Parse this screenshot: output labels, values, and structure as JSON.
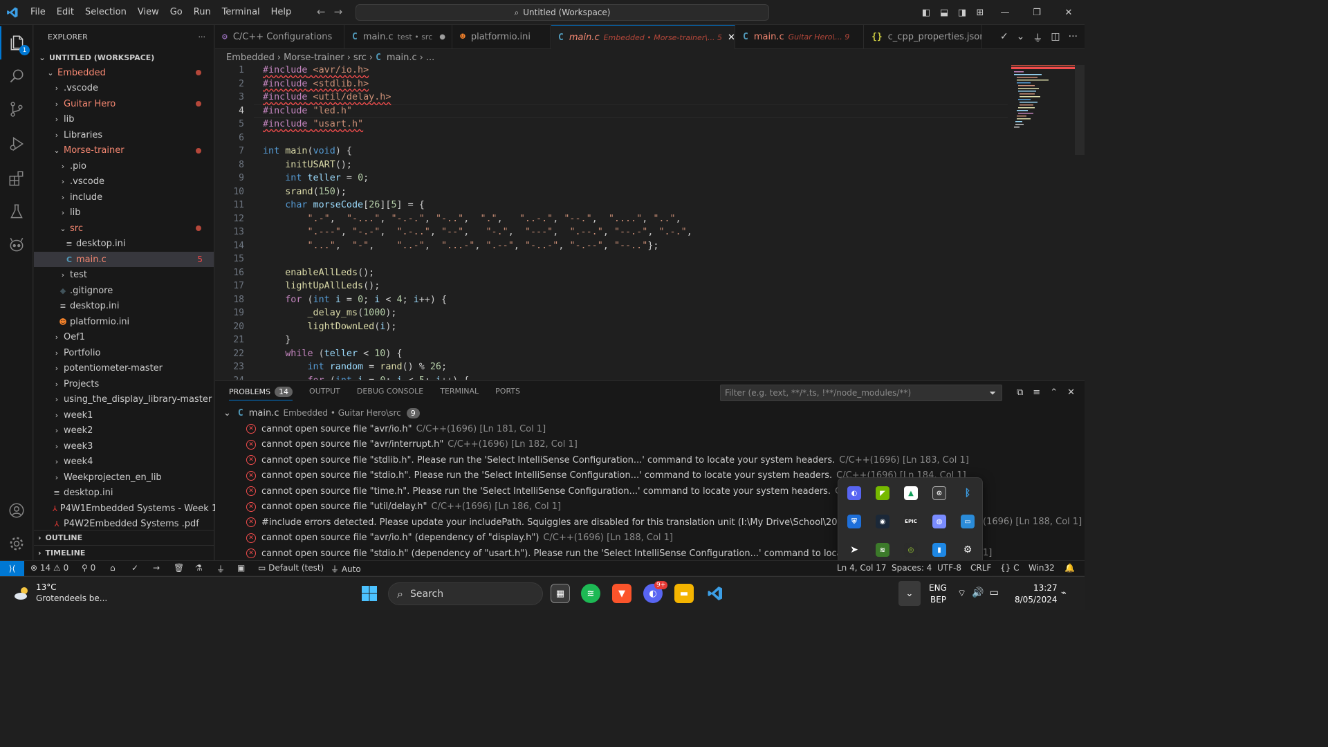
{
  "titlebar": {
    "menu": [
      "File",
      "Edit",
      "Selection",
      "View",
      "Go",
      "Run",
      "Terminal",
      "Help"
    ],
    "command_center": "Untitled (Workspace)"
  },
  "activity": {
    "explorer_badge": "1"
  },
  "sidebar": {
    "header": "EXPLORER",
    "workspace": "UNTITLED (WORKSPACE)",
    "items": [
      {
        "label": "Embedded",
        "depth": 0,
        "kind": "open",
        "mod": true
      },
      {
        "label": ".vscode",
        "depth": 1,
        "kind": "closed"
      },
      {
        "label": "Guitar Hero",
        "depth": 1,
        "kind": "closed",
        "mod": true
      },
      {
        "label": "lib",
        "depth": 1,
        "kind": "closed"
      },
      {
        "label": "Libraries",
        "depth": 1,
        "kind": "closed"
      },
      {
        "label": "Morse-trainer",
        "depth": 1,
        "kind": "open",
        "mod": true
      },
      {
        "label": ".pio",
        "depth": 2,
        "kind": "closed"
      },
      {
        "label": ".vscode",
        "depth": 2,
        "kind": "closed"
      },
      {
        "label": "include",
        "depth": 2,
        "kind": "closed"
      },
      {
        "label": "lib",
        "depth": 2,
        "kind": "closed"
      },
      {
        "label": "src",
        "depth": 2,
        "kind": "open",
        "mod": true
      },
      {
        "label": "desktop.ini",
        "depth": 3,
        "kind": "file-ini"
      },
      {
        "label": "main.c",
        "depth": 3,
        "kind": "file-c",
        "count": "5",
        "selected": true
      },
      {
        "label": "test",
        "depth": 2,
        "kind": "closed"
      },
      {
        "label": ".gitignore",
        "depth": 2,
        "kind": "file-git"
      },
      {
        "label": "desktop.ini",
        "depth": 2,
        "kind": "file-ini"
      },
      {
        "label": "platformio.ini",
        "depth": 2,
        "kind": "file-pio"
      },
      {
        "label": "Oef1",
        "depth": 1,
        "kind": "closed"
      },
      {
        "label": "Portfolio",
        "depth": 1,
        "kind": "closed"
      },
      {
        "label": "potentiometer-master",
        "depth": 1,
        "kind": "closed"
      },
      {
        "label": "Projects",
        "depth": 1,
        "kind": "closed"
      },
      {
        "label": "using_the_display_library-master",
        "depth": 1,
        "kind": "closed"
      },
      {
        "label": "week1",
        "depth": 1,
        "kind": "closed"
      },
      {
        "label": "week2",
        "depth": 1,
        "kind": "closed"
      },
      {
        "label": "week3",
        "depth": 1,
        "kind": "closed"
      },
      {
        "label": "week4",
        "depth": 1,
        "kind": "closed"
      },
      {
        "label": "Weekprojecten_en_lib",
        "depth": 1,
        "kind": "closed"
      },
      {
        "label": "desktop.ini",
        "depth": 1,
        "kind": "file-ini"
      },
      {
        "label": "P4W1Embedded Systems - Week 1....",
        "depth": 1,
        "kind": "file-pdf"
      },
      {
        "label": "P4W2Embedded Systems .pdf",
        "depth": 1,
        "kind": "file-pdf"
      }
    ],
    "outline": "OUTLINE",
    "timeline": "TIMELINE"
  },
  "tabs": [
    {
      "label": "C/C++ Configurations",
      "desc": "",
      "icon": "config"
    },
    {
      "label": "main.c",
      "desc": "test • src",
      "icon": "c",
      "dirty": true
    },
    {
      "label": "platformio.ini",
      "desc": "",
      "icon": "pio"
    },
    {
      "label": "main.c",
      "desc": "Embedded • Morse-trainer\\... 5",
      "icon": "c",
      "active": true
    },
    {
      "label": "main.c",
      "desc": "Guitar Hero\\... 9",
      "icon": "c"
    },
    {
      "label": "c_cpp_properties.json",
      "desc": "",
      "icon": "json"
    }
  ],
  "breadcrumb": [
    "Embedded",
    "Morse-trainer",
    "src",
    "main.c",
    "..."
  ],
  "editor": {
    "line_numbers": [
      "1",
      "2",
      "3",
      "4",
      "5",
      "6",
      "7",
      "8",
      "9",
      "10",
      "11",
      "12",
      "13",
      "14",
      "15",
      "16",
      "17",
      "18",
      "19",
      "20",
      "21",
      "22",
      "23",
      "24"
    ],
    "current_line": 4
  },
  "panel": {
    "tabs": [
      "PROBLEMS",
      "OUTPUT",
      "DEBUG CONSOLE",
      "TERMINAL",
      "PORTS"
    ],
    "problems_count": "14",
    "filter_placeholder": "Filter (e.g. text, **/*.ts, !**/node_modules/**)",
    "group": {
      "file": "main.c",
      "path": "Embedded • Guitar Hero\\src",
      "count": "9"
    },
    "problems": [
      {
        "msg": "cannot open source file \"avr/io.h\"",
        "meta": "C/C++(1696)  [Ln 181, Col 1]"
      },
      {
        "msg": "cannot open source file \"avr/interrupt.h\"",
        "meta": "C/C++(1696)  [Ln 182, Col 1]"
      },
      {
        "msg": "cannot open source file \"stdlib.h\". Please run the 'Select IntelliSense Configuration...' command to locate your system headers.",
        "meta": "C/C++(1696)  [Ln 183, Col 1]"
      },
      {
        "msg": "cannot open source file \"stdio.h\". Please run the 'Select IntelliSense Configuration...' command to locate your system headers.",
        "meta": "C/C++(1696)  [Ln 184, Col 1]"
      },
      {
        "msg": "cannot open source file \"time.h\". Please run the 'Select IntelliSense Configuration...' command to locate your system headers.",
        "meta": "C/C++(1696)  [Ln"
      },
      {
        "msg": "cannot open source file \"util/delay.h\"",
        "meta": "C/C++(1696)  [Ln 186, Col 1]"
      },
      {
        "msg": "#include errors detected. Please update your includePath. Squiggles are disabled for this translation unit (I:\\My Drive\\School\\2022-2023\\Progra",
        "meta": ""
      },
      {
        "msg": "cannot open source file \"avr/io.h\" (dependency of \"display.h\")",
        "meta": "C/C++(1696)  [Ln 188, Col 1]"
      },
      {
        "msg": "cannot open source file \"stdio.h\" (dependency of \"usart.h\"). Please run the 'Select IntelliSense Configuration...' command to locate your system",
        "meta": ""
      }
    ],
    "overflow_meta": "(1696)  [Ln 188, Col 1]",
    "overflow_meta2": "1]"
  },
  "statusbar": {
    "errors": "14",
    "warnings": "0",
    "ports": "0",
    "env": "Default (test)",
    "port_auto": "Auto",
    "position": "Ln 4, Col 17",
    "spaces": "Spaces: 4",
    "encoding": "UTF-8",
    "eol": "CRLF",
    "language": "C",
    "platform": "Win32"
  },
  "taskbar": {
    "weather_temp": "13°C",
    "weather_desc": "Grotendeels be...",
    "search": "Search",
    "discord_badge": "9+",
    "lang1": "ENG",
    "lang2": "BEP",
    "time": "13:27",
    "date": "8/05/2024"
  }
}
